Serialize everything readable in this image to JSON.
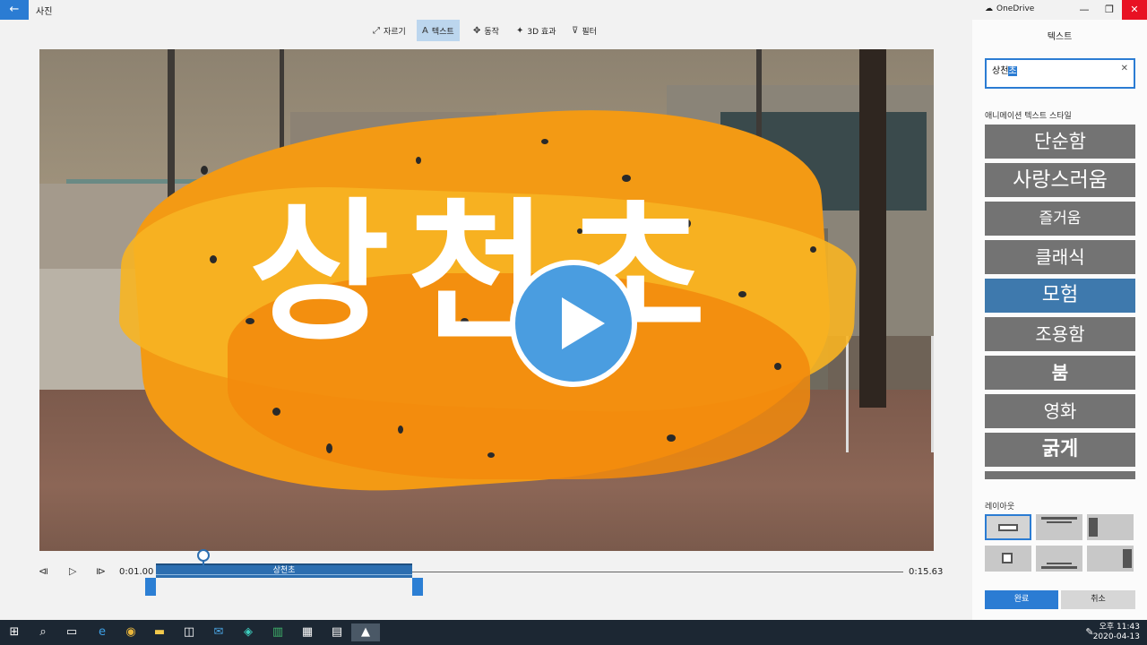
{
  "app": {
    "title": "사진",
    "back_icon": "back-arrow-icon"
  },
  "toolbar": {
    "items": [
      {
        "label": "자르기",
        "icon": "crop-icon"
      },
      {
        "label": "텍스트",
        "icon": "text-icon",
        "active": true
      },
      {
        "label": "동작",
        "icon": "motion-icon"
      },
      {
        "label": "3D 효과",
        "icon": "3d-effects-icon"
      },
      {
        "label": "필터",
        "icon": "filter-icon"
      }
    ]
  },
  "preview": {
    "overlay_text": "상천초",
    "play_icon": "play-icon"
  },
  "timeline": {
    "start_time": "0:01.00",
    "end_time": "0:15.63",
    "clip_label": "상천초",
    "transport_icons": [
      "step-back-icon",
      "play-icon",
      "step-forward-icon"
    ]
  },
  "panel": {
    "window": {
      "onedrive_label": "OneDrive",
      "minimize": "—",
      "restore": "❐",
      "close": "✕"
    },
    "title": "텍스트",
    "text_input": {
      "value_plain": "상천",
      "value_selected": "초",
      "clear_icon": "clear-icon"
    },
    "style_header": "애니메이션 텍스트 스타일",
    "styles": [
      {
        "label": "단순함"
      },
      {
        "label": "사랑스러움"
      },
      {
        "label": "즐거움"
      },
      {
        "label": "클래식"
      },
      {
        "label": "모험",
        "active": true
      },
      {
        "label": "조용함"
      },
      {
        "label": "붐"
      },
      {
        "label": "영화"
      },
      {
        "label": "굵게"
      },
      {
        "label": ""
      }
    ],
    "layout_header": "레이아웃",
    "done_label": "완료",
    "cancel_label": "취소"
  },
  "taskbar": {
    "time": "오후 11:43",
    "date": "2020-04-13",
    "icons": [
      "windows-icon",
      "search-icon",
      "task-view-icon",
      "edge-icon",
      "chrome-icon",
      "file-explorer-icon",
      "store-icon",
      "mail-icon",
      "app-icon",
      "excel-icon",
      "calculator-icon",
      "word-icon",
      "photos-icon"
    ]
  },
  "colors": {
    "accent": "#2b7cd3",
    "style_active": "#3e79ad",
    "style_bg": "#737373",
    "brush_orange": "#f39a14"
  }
}
